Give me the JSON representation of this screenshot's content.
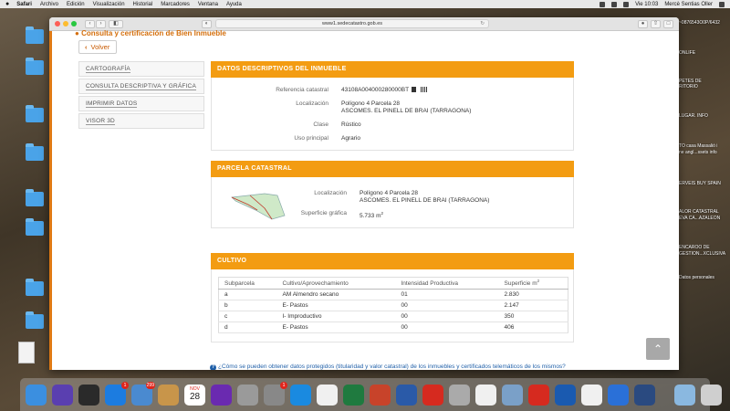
{
  "menubar": {
    "apple": "",
    "menus": [
      "Safari",
      "Archivo",
      "Edición",
      "Visualización",
      "Historial",
      "Marcadores",
      "Ventana",
      "Ayuda"
    ],
    "clock": "Vie 10:03",
    "user": "Mercè Sentias Oller"
  },
  "browser": {
    "url": "www1.sedecatastro.gob.es"
  },
  "page": {
    "title": "Consulta y certificación de Bien Inmueble",
    "back_label": "Volver",
    "nav": [
      "CARTOGRAFÍA",
      "CONSULTA DESCRIPTIVA Y GRÁFICA",
      "IMPRIMIR DATOS",
      "VISOR 3D"
    ],
    "datos": {
      "header": "DATOS DESCRIPTIVOS DEL INMUEBLE",
      "ref_label": "Referencia catastral",
      "ref_value": "43108A004000280000BT",
      "loc_label": "Localización",
      "loc_line1": "Polígono 4 Parcela 28",
      "loc_line2": "ASCOMES. EL PINELL DE BRAI (TARRAGONA)",
      "clase_label": "Clase",
      "clase_value": "Rústico",
      "uso_label": "Uso principal",
      "uso_value": "Agrario"
    },
    "parcela": {
      "header": "PARCELA CATASTRAL",
      "loc_label": "Localización",
      "loc_line1": "Polígono 4 Parcela 28",
      "loc_line2": "ASCOMES. EL PINELL DE BRAI (TARRAGONA)",
      "sup_label": "Superficie gráfica",
      "sup_value": "5.733 m",
      "sup_exp": "2"
    },
    "cultivo": {
      "header": "CULTIVO",
      "columns": [
        "Subparcela",
        "Cultivo/Aprovechamiento",
        "Intensidad Productiva",
        "Superficie m"
      ],
      "sup_exp": "2",
      "rows": [
        [
          "a",
          "AM Almendro secano",
          "01",
          "2.830"
        ],
        [
          "b",
          "E- Pastos",
          "00",
          "2.147"
        ],
        [
          "c",
          "I- Improductivo",
          "00",
          "350"
        ],
        [
          "d",
          "E- Pastos",
          "00",
          "406"
        ]
      ]
    },
    "footnote": "¿Cómo se pueden obtener datos protegidos (titularidad y valor catastral) de los inmuebles y certificados telemáticos de los mismos?"
  },
  "desktop_right": [
    "~0876543O0P/6432",
    "ONLIFE",
    "PETES DE",
    "RITORIO",
    "LUGAR. INFO",
    "TO casa Massalió i",
    "ne angl...ssets info",
    "ERVEIS BUY SPAIN",
    "ALOR CATASTRAL",
    "EVA CA...AZALEON",
    "ENCAROO DE",
    "GESTION...XCLUSIVA",
    "Datos personales"
  ],
  "dock": {
    "badges": {
      "appstore": "1",
      "photos": "299",
      "prefs": "1"
    },
    "calendar_month": "NOV",
    "calendar_day": "28",
    "apps": [
      {
        "name": "finder",
        "color": "#3b8fe0"
      },
      {
        "name": "siri",
        "color": "#5a3fb0"
      },
      {
        "name": "mission-control",
        "color": "#2a2a2a"
      },
      {
        "name": "appstore",
        "color": "#1c7ce0"
      },
      {
        "name": "photos",
        "color": "#4a8ad0"
      },
      {
        "name": "notes",
        "color": "#c8954a"
      },
      {
        "name": "calendar",
        "color": "#ffffff"
      },
      {
        "name": "imovie",
        "color": "#6a2ab0"
      },
      {
        "name": "blocked",
        "color": "#9a9a9a"
      },
      {
        "name": "prefs",
        "color": "#888888"
      },
      {
        "name": "safari",
        "color": "#1a8ae0"
      },
      {
        "name": "photos-app",
        "color": "#f0f0f0"
      },
      {
        "name": "excel",
        "color": "#1f7a3f"
      },
      {
        "name": "powerpoint",
        "color": "#c8432a"
      },
      {
        "name": "word",
        "color": "#2a5aa8"
      },
      {
        "name": "acrobat",
        "color": "#d62a1f"
      },
      {
        "name": "blocked2",
        "color": "#aaaaaa"
      },
      {
        "name": "music",
        "color": "#f0f0f0"
      },
      {
        "name": "preview",
        "color": "#7aa0c8"
      },
      {
        "name": "acrobat2",
        "color": "#d62a1f"
      },
      {
        "name": "teamviewer",
        "color": "#1a5ab0"
      },
      {
        "name": "chrome",
        "color": "#f0f0f0"
      },
      {
        "name": "shazam",
        "color": "#2a70d8"
      },
      {
        "name": "quicktime",
        "color": "#2a4a80"
      },
      {
        "name": "downloads",
        "color": "#8ab8e0"
      },
      {
        "name": "trash",
        "color": "#cfcfcf"
      }
    ]
  }
}
